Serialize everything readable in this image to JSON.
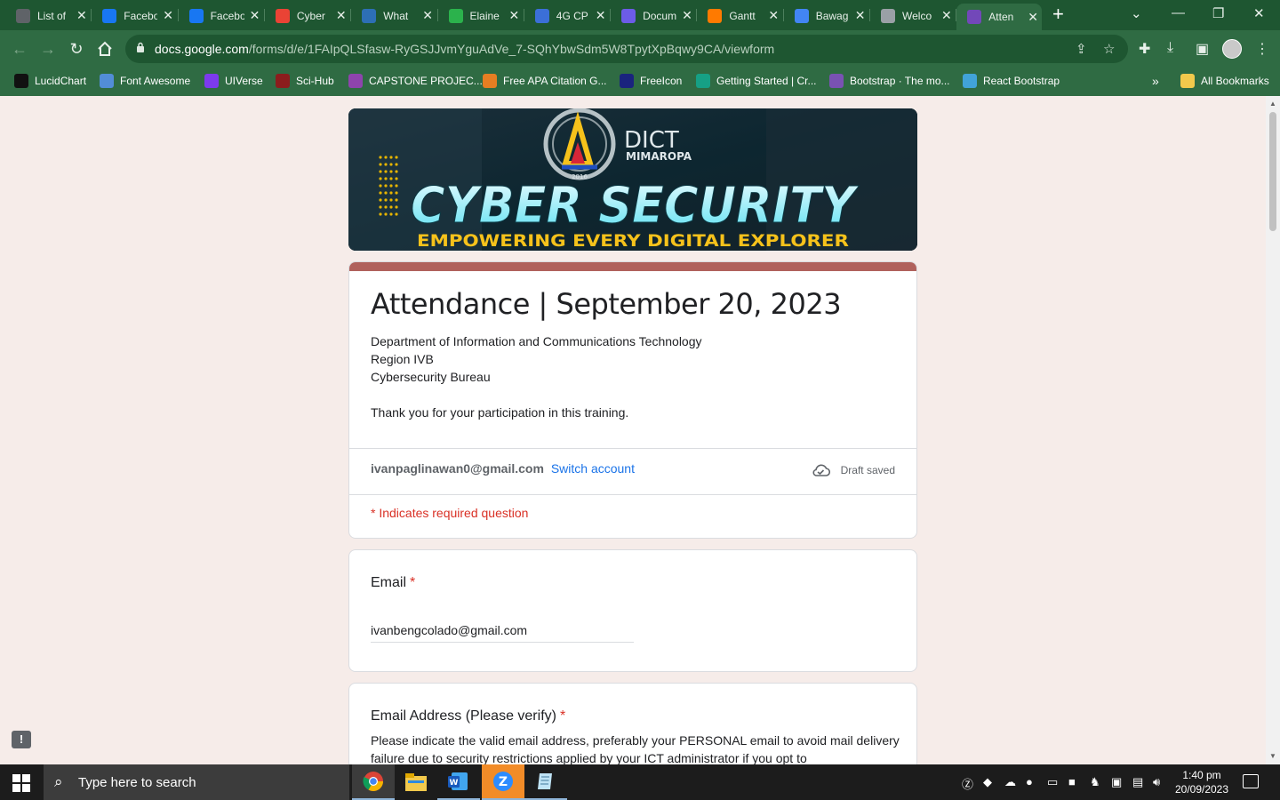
{
  "browser": {
    "tabs": [
      {
        "title": "List of",
        "icon": "doc-icon",
        "color": "#5f6368"
      },
      {
        "title": "Facebook",
        "icon": "facebook-icon",
        "color": "#1877f2"
      },
      {
        "title": "Facebook",
        "icon": "facebook-icon",
        "color": "#1877f2"
      },
      {
        "title": "Cyber",
        "icon": "gmail-icon",
        "color": "#ea4335"
      },
      {
        "title": "What",
        "icon": "r-icon",
        "color": "#2d6fb5"
      },
      {
        "title": "Elaine",
        "icon": "chat-icon",
        "color": "#2bb24c"
      },
      {
        "title": "4G CP",
        "icon": "g-icon",
        "color": "#3b6fd8"
      },
      {
        "title": "Docum",
        "icon": "lucid-icon",
        "color": "#6c5ce7"
      },
      {
        "title": "Gantt",
        "icon": "gantt-icon",
        "color": "#ff7a00"
      },
      {
        "title": "Bawag",
        "icon": "docs-icon",
        "color": "#4285f4"
      },
      {
        "title": "Welco",
        "icon": "globe-icon",
        "color": "#9aa0a6"
      },
      {
        "title": "Atten",
        "icon": "forms-icon",
        "color": "#7248b9"
      }
    ],
    "active_tab_index": 11,
    "url_host": "docs.google.com",
    "url_path": "/forms/d/e/1FAIpQLSfasw-RyGSJJvmYguAdVe_7-SQhYbwSdm5W8TpytXpBqwy9CA/viewform",
    "bookmarks": [
      {
        "label": "LucidChart",
        "icon": "lucidchart-icon",
        "color": "#111111"
      },
      {
        "label": "Font Awesome",
        "icon": "flag-icon",
        "color": "#528dd7"
      },
      {
        "label": "UIVerse",
        "icon": "uiverse-icon",
        "color": "#7c3aed"
      },
      {
        "label": "Sci-Hub",
        "icon": "scihub-icon",
        "color": "#8b1d1d"
      },
      {
        "label": "CAPSTONE PROJEC...",
        "icon": "capstone-icon",
        "color": "#8e44ad"
      },
      {
        "label": "Free APA Citation G...",
        "icon": "citation-icon",
        "color": "#e67e22"
      },
      {
        "label": "FreeIcon",
        "icon": "freeicon-icon",
        "color": "#1a237e"
      },
      {
        "label": "Getting Started | Cr...",
        "icon": "gear-icon",
        "color": "#16a085"
      },
      {
        "label": "Bootstrap · The mo...",
        "icon": "bootstrap-icon",
        "color": "#7952b3"
      },
      {
        "label": "React Bootstrap",
        "icon": "react-icon",
        "color": "#41a3d8"
      }
    ],
    "all_bookmarks_label": "All Bookmarks"
  },
  "form": {
    "title": "Attendance | September 20, 2023",
    "description": "Department of Information and Communications Technology\nRegion IVB\nCybersecurity Bureau\n\nThank you for your participation in this training.",
    "account_email": "ivanpaglinawan0@gmail.com",
    "switch_account_label": "Switch account",
    "draft_status": "Draft saved",
    "required_note": "* Indicates required question",
    "accent_color": "#b0615c",
    "questions": [
      {
        "title": "Email",
        "required_mark": "*",
        "answer": "ivanbengcolado@gmail.com"
      },
      {
        "title": "Email Address (Please verify)",
        "required_mark": "*",
        "help": "Please indicate the valid email address, preferably your PERSONAL email to avoid mail delivery failure due to security restrictions applied by your ICT administrator if you opt to"
      }
    ]
  },
  "banner": {
    "org": "DICT",
    "region": "MIMAROPA",
    "headline": "CYBER SECURITY",
    "tagline": "EMPOWERING EVERY DIGITAL EXPLORER",
    "year": "2016"
  },
  "taskbar": {
    "search_placeholder": "Type here to search",
    "time": "1:40 pm",
    "date": "20/09/2023"
  }
}
